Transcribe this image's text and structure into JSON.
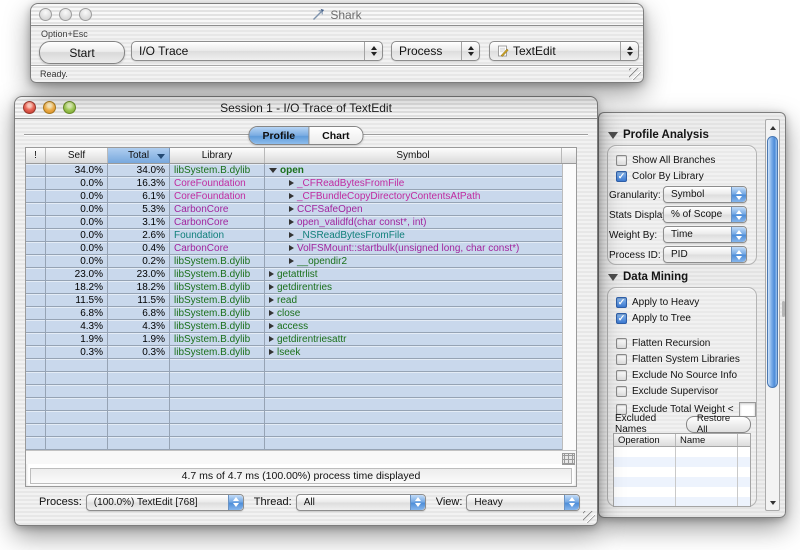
{
  "shark_window": {
    "title": "Shark",
    "hotkey_label": "Option+Esc",
    "start_button": "Start",
    "config_popup": "I/O Trace",
    "target_popup": "Process",
    "process_popup": "TextEdit",
    "status": "Ready."
  },
  "session_window": {
    "title": "Session 1 - I/O Trace of TextEdit",
    "tabs": [
      {
        "label": "Profile",
        "selected": true
      },
      {
        "label": "Chart",
        "selected": false
      }
    ],
    "table": {
      "columns": [
        "!",
        "Self",
        "Total",
        "Library",
        "Symbol"
      ],
      "sort_column": "Total",
      "rows": [
        {
          "self": "34.0%",
          "total": "34.0%",
          "library": "libSystem.B.dylib",
          "symbol": "open",
          "disclosure": "open",
          "indent": 0,
          "color": "#1a701a"
        },
        {
          "self": "0.0%",
          "total": "16.3%",
          "library": "CoreFoundation",
          "symbol": "_CFReadBytesFromFile",
          "disclosure": "closed",
          "indent": 1,
          "color": "#c02ba0"
        },
        {
          "self": "0.0%",
          "total": "6.1%",
          "library": "CoreFoundation",
          "symbol": "_CFBundleCopyDirectoryContentsAtPath",
          "disclosure": "closed",
          "indent": 1,
          "color": "#c02ba0"
        },
        {
          "self": "0.0%",
          "total": "5.3%",
          "library": "CarbonCore",
          "symbol": "CCFSafeOpen",
          "disclosure": "closed",
          "indent": 1,
          "color": "#a2259e"
        },
        {
          "self": "0.0%",
          "total": "3.1%",
          "library": "CarbonCore",
          "symbol": "open_validfd(char const*, int)",
          "disclosure": "closed",
          "indent": 1,
          "color": "#a2259e"
        },
        {
          "self": "0.0%",
          "total": "2.6%",
          "library": "Foundation",
          "symbol": "_NSReadBytesFromFile",
          "disclosure": "closed",
          "indent": 1,
          "color": "#0f7f7a"
        },
        {
          "self": "0.0%",
          "total": "0.4%",
          "library": "CarbonCore",
          "symbol": "VolFSMount::startbulk(unsigned long, char const*)",
          "disclosure": "closed",
          "indent": 1,
          "color": "#a2259e"
        },
        {
          "self": "0.0%",
          "total": "0.2%",
          "library": "libSystem.B.dylib",
          "symbol": "__opendir2",
          "disclosure": "closed",
          "indent": 1,
          "color": "#1a701a"
        },
        {
          "self": "23.0%",
          "total": "23.0%",
          "library": "libSystem.B.dylib",
          "symbol": "getattrlist",
          "disclosure": "closed",
          "indent": 0,
          "color": "#1a701a"
        },
        {
          "self": "18.2%",
          "total": "18.2%",
          "library": "libSystem.B.dylib",
          "symbol": "getdirentries",
          "disclosure": "closed",
          "indent": 0,
          "color": "#1a701a"
        },
        {
          "self": "11.5%",
          "total": "11.5%",
          "library": "libSystem.B.dylib",
          "symbol": "read",
          "disclosure": "closed",
          "indent": 0,
          "color": "#1a701a"
        },
        {
          "self": "6.8%",
          "total": "6.8%",
          "library": "libSystem.B.dylib",
          "symbol": "close",
          "disclosure": "closed",
          "indent": 0,
          "color": "#1a701a"
        },
        {
          "self": "4.3%",
          "total": "4.3%",
          "library": "libSystem.B.dylib",
          "symbol": "access",
          "disclosure": "closed",
          "indent": 0,
          "color": "#1a701a"
        },
        {
          "self": "1.9%",
          "total": "1.9%",
          "library": "libSystem.B.dylib",
          "symbol": "getdirentriesattr",
          "disclosure": "closed",
          "indent": 0,
          "color": "#1a701a"
        },
        {
          "self": "0.3%",
          "total": "0.3%",
          "library": "libSystem.B.dylib",
          "symbol": "lseek",
          "disclosure": "closed",
          "indent": 0,
          "color": "#1a701a"
        }
      ],
      "empty_row_count": 7
    },
    "status_text": "4.7 ms of 4.7 ms (100.00%) process time displayed",
    "footer": {
      "process_label": "Process:",
      "process_value": "(100.0%) TextEdit [768]",
      "thread_label": "Thread:",
      "thread_value": "All",
      "view_label": "View:",
      "view_value": "Heavy"
    }
  },
  "drawer": {
    "profile_analysis": {
      "title": "Profile Analysis",
      "checkboxes": [
        {
          "label": "Show All Branches",
          "checked": false
        },
        {
          "label": "Color By Library",
          "checked": true
        }
      ],
      "popups": [
        {
          "label": "Granularity:",
          "value": "Symbol"
        },
        {
          "label": "Stats Display:",
          "value": "% of Scope"
        },
        {
          "label": "Weight By:",
          "value": "Time"
        },
        {
          "label": "Process ID:",
          "value": "PID"
        }
      ]
    },
    "data_mining": {
      "title": "Data Mining",
      "checkboxes_top": [
        {
          "label": "Apply to Heavy",
          "checked": true
        },
        {
          "label": "Apply to Tree",
          "checked": true
        }
      ],
      "checkboxes_bottom": [
        {
          "label": "Flatten Recursion",
          "checked": false
        },
        {
          "label": "Flatten System Libraries",
          "checked": false
        },
        {
          "label": "Exclude No Source Info",
          "checked": false
        },
        {
          "label": "Exclude Supervisor",
          "checked": false
        },
        {
          "label": "Exclude Total Weight <",
          "checked": false,
          "has_field": true,
          "field_value": ""
        }
      ],
      "excluded_names": {
        "label": "Excluded Names",
        "button": "Restore All",
        "columns": [
          "Operation",
          "Name"
        ],
        "empty_row_count": 6
      }
    }
  },
  "colors": {
    "row_blue": "#c9d8ec",
    "sorted_header_blue": "#78a8dd",
    "selected_tab_blue": "#7aace2",
    "libSystem_green": "#1a701a",
    "coreFoundation_magenta": "#c02ba0",
    "carbonCore_purple": "#a2259e",
    "foundation_teal": "#0f7f7a"
  }
}
